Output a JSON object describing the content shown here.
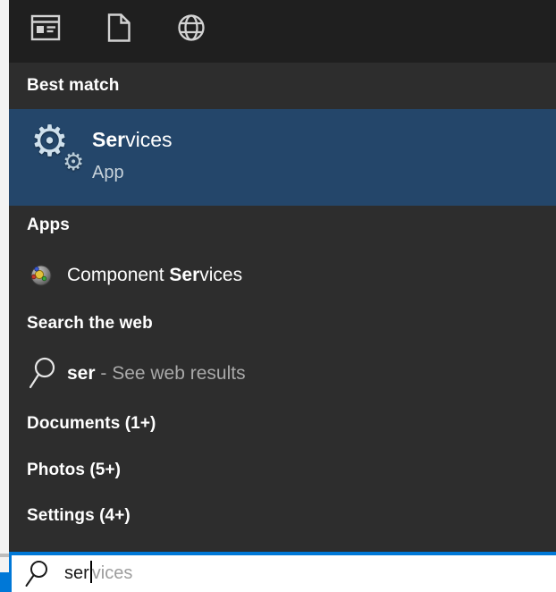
{
  "app": {
    "name": "Windows Search flyout"
  },
  "topbar": {
    "icons": [
      {
        "name": "apps-filter-icon"
      },
      {
        "name": "documents-filter-icon"
      },
      {
        "name": "web-filter-icon"
      }
    ]
  },
  "sections": {
    "best_match": {
      "header": "Best match",
      "result": {
        "title_match": "Ser",
        "title_rest": "vices",
        "subtitle": "App",
        "icon": "services-gears"
      }
    },
    "apps": {
      "header": "Apps",
      "result": {
        "prefix": "Component ",
        "match": "Ser",
        "rest": "vices",
        "icon": "component-services"
      }
    },
    "web": {
      "header": "Search the web",
      "result": {
        "query": "ser",
        "suffix": " - See web results",
        "icon": "search-magnifier"
      }
    },
    "documents": {
      "header": "Documents (1+)"
    },
    "photos": {
      "header": "Photos (5+)"
    },
    "settings": {
      "header": "Settings (4+)"
    }
  },
  "search_box": {
    "typed": "ser",
    "suggestion": "vices",
    "icon": "search-magnifier"
  },
  "icons": {
    "gear_glyph": "⚙"
  },
  "colors": {
    "accent": "#0078d7",
    "highlight_row": "#24466a",
    "topbar_bg": "#1f1f1f",
    "panel_bg": "#2d2d2d",
    "header_text": "#ffffff",
    "dim_text": "#a9a9a9",
    "ghost_text": "#9d9d9d"
  }
}
